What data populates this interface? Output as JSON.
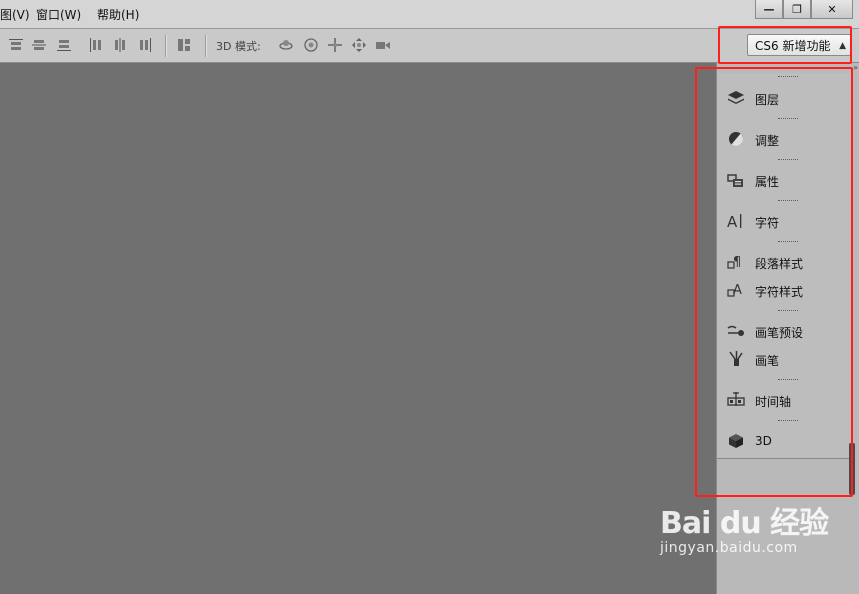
{
  "menubar": {
    "items": [
      {
        "label": "图(V)"
      },
      {
        "label": "窗口(W)"
      },
      {
        "label": "帮助(H)"
      }
    ],
    "window_controls": {
      "minimize": "—",
      "restore": "❐",
      "close": "✕"
    }
  },
  "toolbar": {
    "mode_3d_label": "3D 模式:",
    "workspace": {
      "selected": "CS6 新增功能"
    }
  },
  "dock": {
    "panels": [
      {
        "label": "图层",
        "icon": "layers-icon"
      },
      {
        "label": "调整",
        "icon": "adjustments-icon"
      },
      {
        "label": "属性",
        "icon": "properties-icon"
      },
      {
        "label": "字符",
        "icon": "character-icon"
      },
      {
        "label": "段落样式",
        "icon": "paragraph-styles-icon"
      },
      {
        "label": "字符样式",
        "icon": "character-styles-icon"
      },
      {
        "label": "画笔预设",
        "icon": "brush-presets-icon"
      },
      {
        "label": "画笔",
        "icon": "brush-icon"
      },
      {
        "label": "时间轴",
        "icon": "timeline-icon"
      },
      {
        "label": "3D",
        "icon": "3d-cube-icon"
      }
    ]
  },
  "watermark": {
    "logo": "Bai du 经验",
    "site": "jingyan.baidu.com"
  },
  "colors": {
    "highlight": "#ff1e1e",
    "canvas": "#707070",
    "panel": "#bdbdbd"
  }
}
